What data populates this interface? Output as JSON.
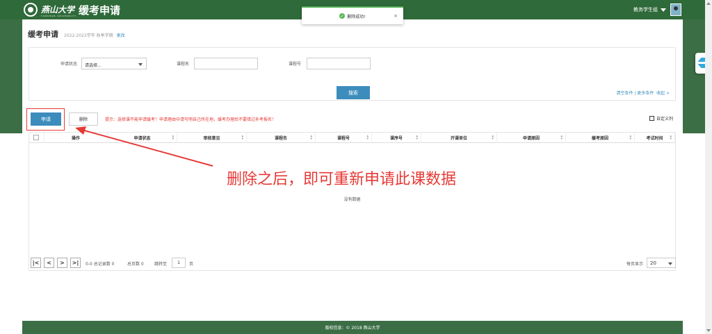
{
  "header": {
    "school_name": "燕山大学",
    "school_en": "YANSHAN UNIVERSITY",
    "app_title": "缓考申请",
    "user_name": "教务学生组"
  },
  "toast": {
    "message": "删除成功!",
    "close": "×"
  },
  "page": {
    "title": "缓考申请",
    "term": "2022-2023学年 秋季学期",
    "change_link": "更改"
  },
  "search": {
    "status_label": "申请状态",
    "status_value": "请选择...",
    "course_name_label": "课程名",
    "course_no_label": "课程号",
    "search_button": "搜索",
    "clear_link": "清空条件",
    "more_link": "更多条件",
    "collapse_link": "收起 >"
  },
  "toolbar": {
    "apply_button": "申请",
    "delete_button": "删除",
    "tip": "提示：选修课不能申请缓考！申请理由中请写明自己所在地，缓考办理后不要错过补考报名！",
    "custom_cols": "自定义列"
  },
  "table": {
    "columns": [
      "操作",
      "申请状态",
      "审核意见",
      "课程名",
      "课程号",
      "课序号",
      "开课单位",
      "申请原因",
      "缓考原因",
      "考试时间"
    ],
    "empty_text": "没有数据"
  },
  "pager": {
    "first": "|<",
    "prev": "<",
    "next": ">",
    "last": ">|",
    "record_info": "0-0 总记录数 0",
    "page_count": "总页数 0",
    "jump_label": "跳转至",
    "jump_value": "1",
    "page_unit": "页",
    "per_page_label": "每页显示",
    "per_page_value": "20"
  },
  "footer": {
    "copyright": "版权信息：© 2018 燕山大学"
  },
  "annotation": {
    "text": "删除之后，即可重新申请此课数据"
  },
  "colors": {
    "brand_green": "#3b6e45",
    "primary_blue": "#3c8dbc",
    "annotation_red": "#e53935"
  }
}
